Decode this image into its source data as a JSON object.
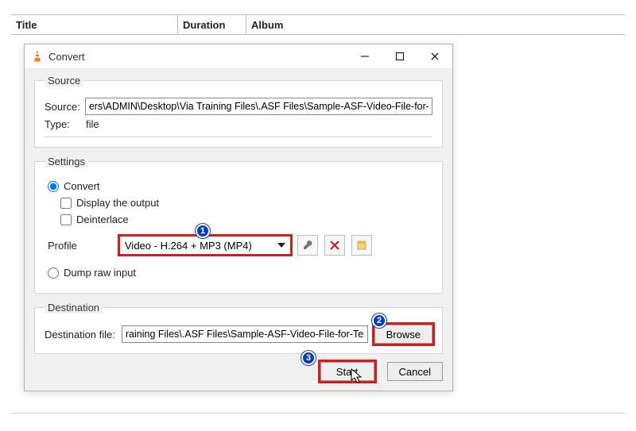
{
  "background_table": {
    "columns": [
      "Title",
      "Duration",
      "Album"
    ]
  },
  "dialog": {
    "title": "Convert",
    "source_group": {
      "legend": "Source",
      "source_label": "Source:",
      "source_value": "ers\\ADMIN\\Desktop\\Via Training Files\\.ASF Files\\Sample-ASF-Video-File-for-Testing.asf",
      "type_label": "Type:",
      "type_value": "file"
    },
    "settings_group": {
      "legend": "Settings",
      "convert_label": "Convert",
      "display_output_label": "Display the output",
      "deinterlace_label": "Deinterlace",
      "profile_label": "Profile",
      "profile_value": "Video - H.264 + MP3 (MP4)",
      "dump_raw_label": "Dump raw input"
    },
    "destination_group": {
      "legend": "Destination",
      "dest_label": "Destination file:",
      "dest_value": "raining Files\\.ASF Files\\Sample-ASF-Video-File-for-Testing.asf",
      "browse_label": "Browse"
    },
    "actions": {
      "start_label": "Start",
      "cancel_label": "Cancel"
    },
    "badges": {
      "one": "1",
      "two": "2",
      "three": "3"
    }
  }
}
